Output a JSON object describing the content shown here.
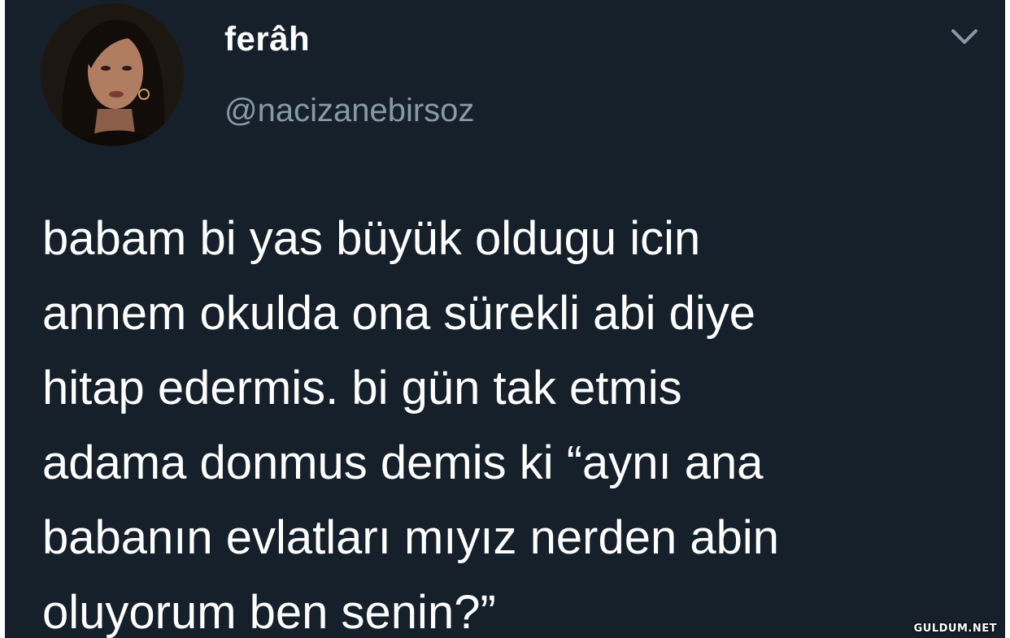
{
  "tweet": {
    "display_name": "ferâh",
    "handle": "@nacizanebirsoz",
    "menu_icon": "chevron-down-icon",
    "text_lines": [
      "babam bi yas büyük oldugu icin",
      "annem okulda ona sürekli abi diye",
      "hitap edermis. bi gün tak etmis",
      "adama donmus demis ki “aynı ana",
      "babanın evlatları mıyız nerden abin",
      "oluyorum ben senin?”"
    ]
  },
  "watermark": "GULDUM.NET",
  "colors": {
    "background": "#15202b",
    "text": "#ffffff",
    "handle": "#8899a6"
  }
}
